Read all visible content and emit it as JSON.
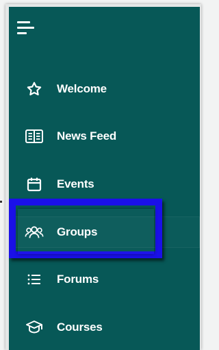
{
  "sidebar": {
    "background": "#075857",
    "menu_toggle_icon": "menu-icon",
    "items": [
      {
        "label": "Welcome",
        "icon": "star-icon"
      },
      {
        "label": "News Feed",
        "icon": "newspaper-icon"
      },
      {
        "label": "Events",
        "icon": "calendar-icon"
      },
      {
        "label": "Groups",
        "icon": "groups-icon",
        "highlighted": true
      },
      {
        "label": "Forums",
        "icon": "list-icon"
      },
      {
        "label": "Courses",
        "icon": "graduation-cap-icon"
      }
    ]
  },
  "highlight": {
    "color": "#1a10e8"
  }
}
